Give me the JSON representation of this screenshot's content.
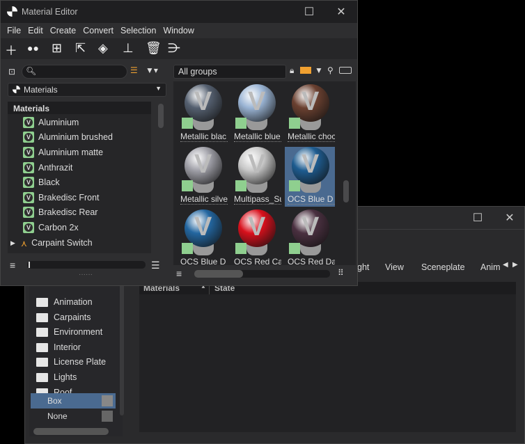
{
  "front": {
    "title": "Material Editor",
    "menu": [
      "File",
      "Edit",
      "Create",
      "Convert",
      "Selection",
      "Window"
    ],
    "search_placeholder": "",
    "group_field": "All groups",
    "materials_dropdown": "Materials",
    "tree_header": "Materials",
    "tree_items": [
      "Aluminium",
      "Aluminium brushed",
      "Aluminium matte",
      "Anthrazit",
      "Black",
      "Brakedisc Front",
      "Brakedisc Rear",
      "Carbon 2x",
      "Carpaint Switch"
    ],
    "grid_items": [
      {
        "label": "Metallic blac",
        "color": "#556070"
      },
      {
        "label": "Metallic blue",
        "color": "#9ab4d4"
      },
      {
        "label": "Metallic choc",
        "color": "#6a4030"
      },
      {
        "label": "Metallic silve",
        "color": "#a0a0a8"
      },
      {
        "label": "Multipass_Su",
        "color": "#c8c8c8"
      },
      {
        "label": "OCS Blue D",
        "color": "#1e5c90"
      },
      {
        "label": "OCS Blue D",
        "color": "#2366a0"
      },
      {
        "label": "OCS Red Car",
        "color": "#d8101c"
      },
      {
        "label": "OCS Red Dar",
        "color": "#4a3040"
      }
    ],
    "selected_index": 5
  },
  "back": {
    "tabs": [
      "ght",
      "View",
      "Sceneplate",
      "Anim"
    ],
    "folders": [
      "Animation",
      "Carpaints",
      "Environment",
      "Interior",
      "License Plate",
      "Lights",
      "Roof"
    ],
    "sub_items": [
      "Box",
      "None"
    ],
    "columns": [
      "Materials",
      "State"
    ]
  }
}
